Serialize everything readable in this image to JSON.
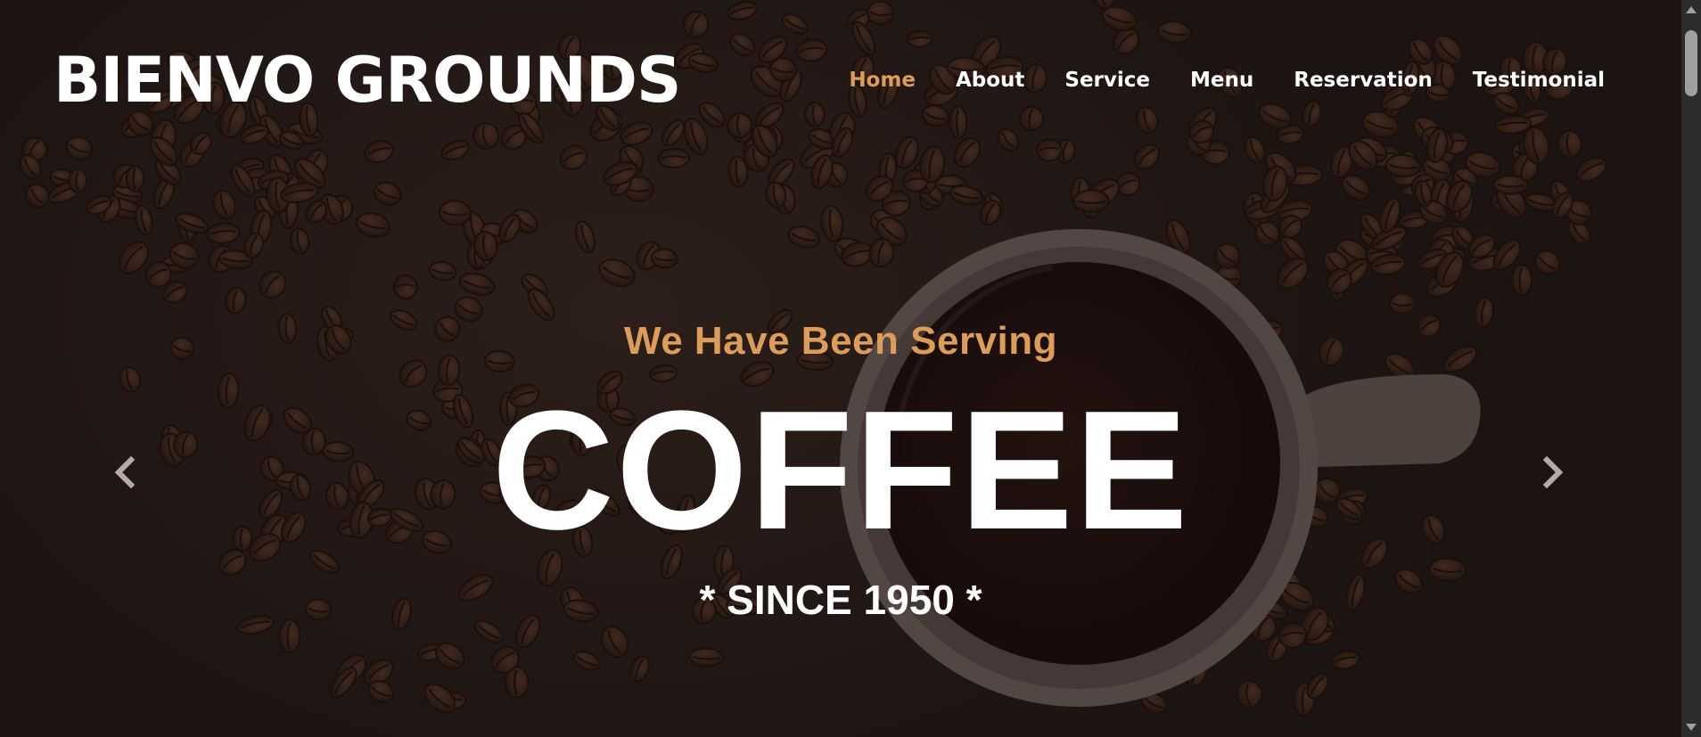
{
  "brand": {
    "name": "BIENVO GROUNDS"
  },
  "nav": {
    "items": [
      {
        "label": "Home",
        "active": true
      },
      {
        "label": "About",
        "active": false
      },
      {
        "label": "Service",
        "active": false
      },
      {
        "label": "Menu",
        "active": false
      },
      {
        "label": "Reservation",
        "active": false
      },
      {
        "label": "Testimonial",
        "active": false
      }
    ]
  },
  "hero": {
    "subtitle": "We Have Been Serving",
    "title": "COFFEE",
    "since": "* SINCE 1950 *"
  },
  "carousel": {
    "prev_icon": "chevron-left-icon",
    "next_icon": "chevron-right-icon"
  },
  "colors": {
    "accent": "#dc9c5a",
    "text": "#ffffff",
    "background": "#2a1f1c"
  }
}
